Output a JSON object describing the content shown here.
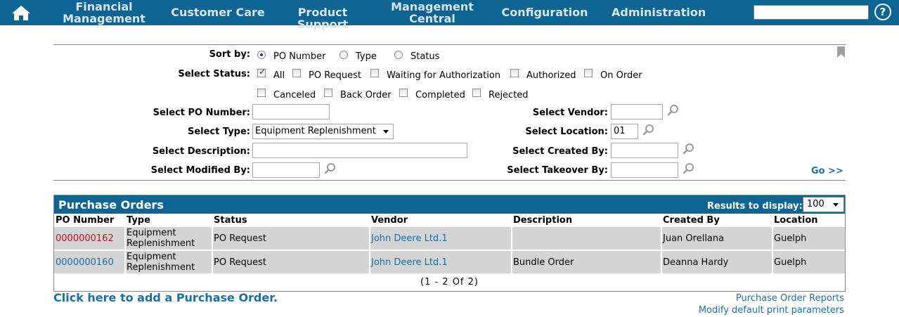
{
  "nav": {
    "items": [
      {
        "label_lines": [
          "Financial",
          "Management"
        ]
      },
      {
        "label_lines": [
          "Customer Care"
        ]
      },
      {
        "label_lines": [
          "Product Support"
        ]
      },
      {
        "label_lines": [
          "Management",
          "Central"
        ]
      },
      {
        "label_lines": [
          "Configuration"
        ]
      },
      {
        "label_lines": [
          "Administration"
        ]
      }
    ],
    "search_value": "",
    "help_glyph": "?",
    "icons": [
      "home-icon",
      "help-icon"
    ]
  },
  "filters": {
    "sort_by": {
      "label": "Sort by:",
      "options": [
        "PO Number",
        "Type",
        "Status"
      ],
      "selected": "PO Number"
    },
    "status": {
      "label": "Select Status:",
      "options_row1": [
        {
          "label": "All",
          "checked": true
        },
        {
          "label": "PO Request",
          "checked": false
        },
        {
          "label": "Waiting for Authorization",
          "checked": false
        },
        {
          "label": "Authorized",
          "checked": false
        },
        {
          "label": "On Order",
          "checked": false
        }
      ],
      "options_row2": [
        {
          "label": "Canceled",
          "checked": false
        },
        {
          "label": "Back Order",
          "checked": false
        },
        {
          "label": "Completed",
          "checked": false
        },
        {
          "label": "Rejected",
          "checked": false
        }
      ]
    },
    "po_number": {
      "label": "Select PO Number:",
      "value": ""
    },
    "type": {
      "label": "Select Type:",
      "value": "Equipment Replenishment"
    },
    "description": {
      "label": "Select Description:",
      "value": ""
    },
    "modified_by": {
      "label": "Select Modified By:",
      "value": ""
    },
    "vendor": {
      "label": "Select Vendor:",
      "value": ""
    },
    "location": {
      "label": "Select Location:",
      "value": "01"
    },
    "created_by": {
      "label": "Select Created By:",
      "value": ""
    },
    "takeover_by": {
      "label": "Select Takeover By:",
      "value": ""
    },
    "go_label": "Go >>"
  },
  "panel": {
    "title": "Purchase Orders",
    "results_label": "Results to display:",
    "results_value": "100",
    "columns": [
      "PO Number",
      "Type",
      "Status",
      "Vendor",
      "Description",
      "Created By",
      "Location"
    ],
    "rows": [
      {
        "po": "0000000162",
        "type_lines": [
          "Equipment",
          "Replenishment"
        ],
        "status": "PO Request",
        "vendor": "John Deere Ltd.1",
        "description": "",
        "created_by": "Juan Orellana",
        "location": "Guelph",
        "po_color": "#c4161c"
      },
      {
        "po": "0000000160",
        "type_lines": [
          "Equipment",
          "Replenishment"
        ],
        "status": "PO Request",
        "vendor": "John Deere Ltd.1",
        "description": "Bundle Order",
        "created_by": "Deanna Hardy",
        "location": "Guelph",
        "po_color": "#1a6fa5"
      }
    ],
    "pager": "(1 - 2 Of 2)"
  },
  "footer": {
    "add_po": "Click here to add a Purchase Order.",
    "reports": "Purchase Order Reports",
    "print_params": "Modify default print parameters"
  },
  "colors": {
    "nav_bg": "#0e6593",
    "link": "#1a6fa5",
    "row_bg": "#d4d4d4"
  }
}
